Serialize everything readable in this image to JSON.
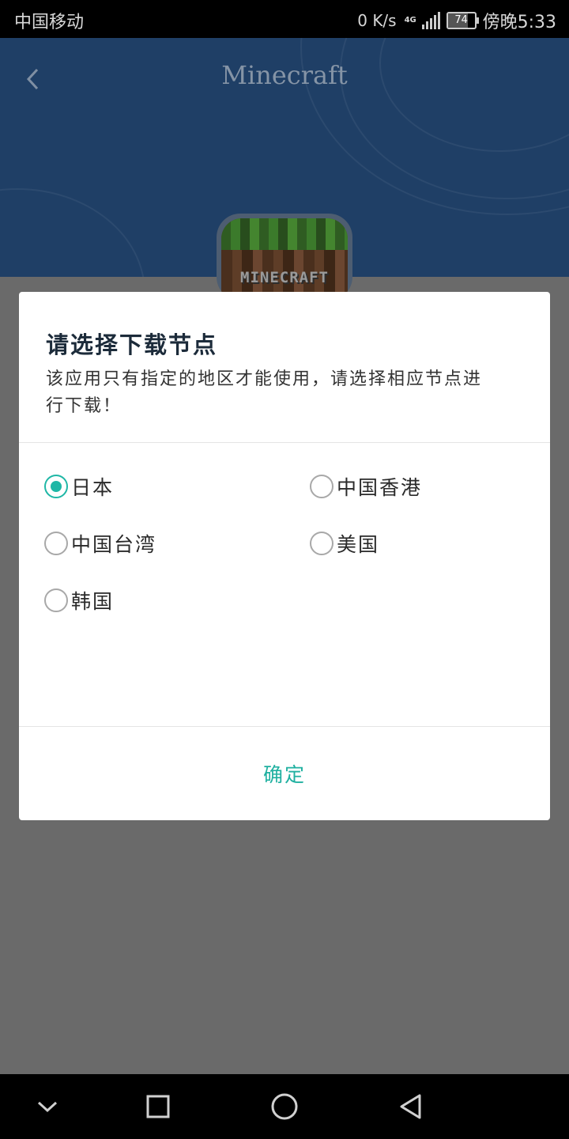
{
  "status_bar": {
    "carrier": "中国移动",
    "speed": "0  K/s",
    "network": "4G",
    "battery": "74",
    "time": "傍晚5:33"
  },
  "header": {
    "title": "Minecraft",
    "back_icon": "chevron-left-icon",
    "background_color": "#1f3f66"
  },
  "app_icon": {
    "logo_text": "MINECRAFT"
  },
  "dialog": {
    "title": "请选择下载节点",
    "description": "该应用只有指定的地区才能使用，请选择相应节点进行下载！",
    "options": [
      {
        "label": "日本",
        "checked": true
      },
      {
        "label": "中国香港",
        "checked": false
      },
      {
        "label": "中国台湾",
        "checked": false
      },
      {
        "label": "美国",
        "checked": false
      },
      {
        "label": "韩国",
        "checked": false
      }
    ],
    "confirm_label": "确定",
    "accent_color": "#1fb7a6"
  },
  "nav_bar": {
    "icons": [
      "chevron-down-icon",
      "square-icon",
      "circle-icon",
      "triangle-back-icon"
    ]
  }
}
